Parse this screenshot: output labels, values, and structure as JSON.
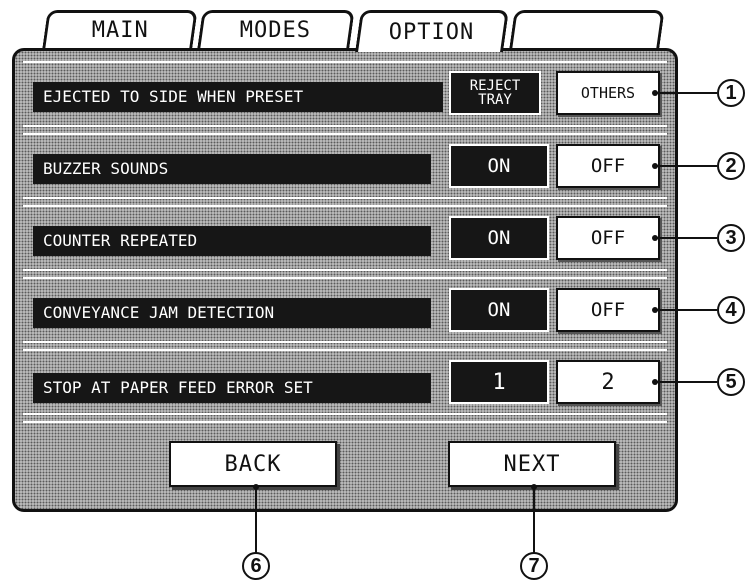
{
  "tabs": [
    {
      "label": "MAIN"
    },
    {
      "label": "MODES"
    },
    {
      "label": "OPTION"
    },
    {
      "label": ""
    }
  ],
  "rows": [
    {
      "label": "EJECTED TO SIDE WHEN PRESET",
      "option_a_line1": "REJECT",
      "option_a_line2": "TRAY",
      "option_b": "OTHERS",
      "callout": "1"
    },
    {
      "label": "BUZZER SOUNDS",
      "option_a": "ON",
      "option_b": "OFF",
      "callout": "2"
    },
    {
      "label": "COUNTER REPEATED",
      "option_a": "ON",
      "option_b": "OFF",
      "callout": "3"
    },
    {
      "label": "CONVEYANCE JAM DETECTION",
      "option_a": "ON",
      "option_b": "OFF",
      "callout": "4"
    },
    {
      "label": "STOP AT PAPER FEED ERROR SET",
      "option_a": "1",
      "option_b": "2",
      "callout": "5"
    }
  ],
  "nav": {
    "back_label": "BACK",
    "next_label": "NEXT",
    "back_callout": "6",
    "next_callout": "7"
  }
}
